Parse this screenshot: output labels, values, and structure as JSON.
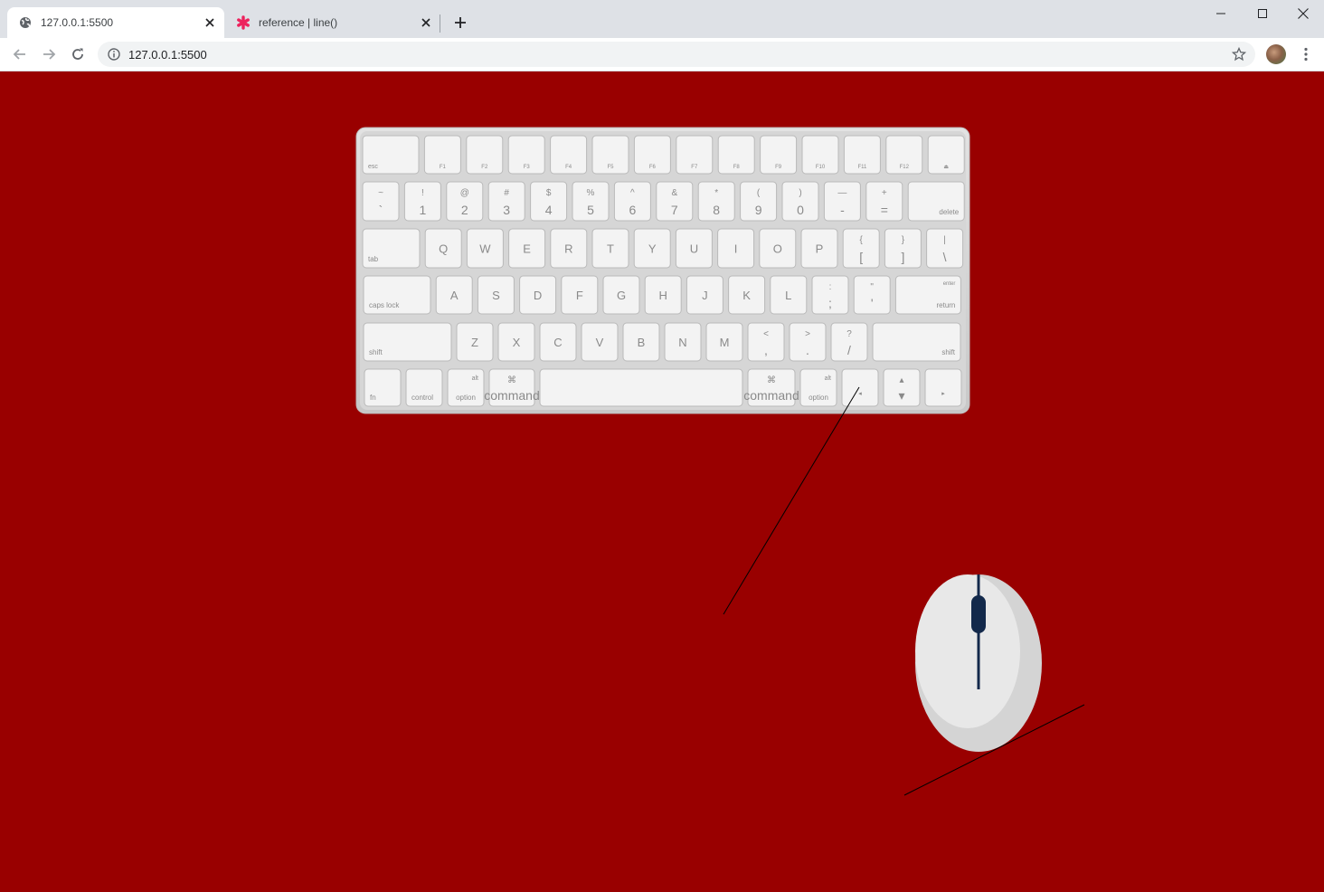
{
  "browser": {
    "tabs": [
      {
        "title": "127.0.0.1:5500",
        "icon": "globe-icon",
        "active": true
      },
      {
        "title": "reference | line()",
        "icon": "asterisk-icon",
        "active": false
      }
    ],
    "address": "127.0.0.1:5500",
    "colors": {
      "titlebar": "#dee1e6",
      "toolbar": "#ffffff",
      "omnibox": "#f1f3f4",
      "favicon_accent": "#ed225d"
    }
  },
  "canvas": {
    "background": "#990000",
    "line_color": "#000000",
    "keyboard": {
      "rows": [
        [
          [
            "esc",
            ""
          ],
          [
            "F1",
            ""
          ],
          [
            "F2",
            ""
          ],
          [
            "F3",
            ""
          ],
          [
            "F4",
            ""
          ],
          [
            "F5",
            ""
          ],
          [
            "F6",
            ""
          ],
          [
            "F7",
            ""
          ],
          [
            "F8",
            ""
          ],
          [
            "F9",
            ""
          ],
          [
            "F10",
            ""
          ],
          [
            "F11",
            ""
          ],
          [
            "F12",
            ""
          ],
          [
            "⏏",
            ""
          ]
        ],
        [
          [
            "~",
            "`"
          ],
          [
            "!",
            "1"
          ],
          [
            "@",
            "2"
          ],
          [
            "#",
            "3"
          ],
          [
            "$",
            "4"
          ],
          [
            "%",
            "5"
          ],
          [
            "^",
            "6"
          ],
          [
            "&",
            "7"
          ],
          [
            "*",
            "8"
          ],
          [
            "(",
            "9"
          ],
          [
            ")",
            "0"
          ],
          [
            "—",
            "-"
          ],
          [
            "+",
            "="
          ],
          [
            "delete",
            ""
          ]
        ],
        [
          [
            "tab",
            ""
          ],
          [
            "Q",
            ""
          ],
          [
            "W",
            ""
          ],
          [
            "E",
            ""
          ],
          [
            "R",
            ""
          ],
          [
            "T",
            ""
          ],
          [
            "Y",
            ""
          ],
          [
            "U",
            ""
          ],
          [
            "I",
            ""
          ],
          [
            "O",
            ""
          ],
          [
            "P",
            ""
          ],
          [
            "{",
            "["
          ],
          [
            "}",
            "]"
          ],
          [
            "|",
            "\\"
          ]
        ],
        [
          [
            "caps lock",
            ""
          ],
          [
            "A",
            ""
          ],
          [
            "S",
            ""
          ],
          [
            "D",
            ""
          ],
          [
            "F",
            ""
          ],
          [
            "G",
            ""
          ],
          [
            "H",
            ""
          ],
          [
            "J",
            ""
          ],
          [
            "K",
            ""
          ],
          [
            "L",
            ""
          ],
          [
            ":",
            ";"
          ],
          [
            "\"",
            "'"
          ],
          [
            "enter",
            "return"
          ]
        ],
        [
          [
            "shift",
            ""
          ],
          [
            "Z",
            ""
          ],
          [
            "X",
            ""
          ],
          [
            "C",
            ""
          ],
          [
            "V",
            ""
          ],
          [
            "B",
            ""
          ],
          [
            "N",
            ""
          ],
          [
            "M",
            ""
          ],
          [
            "<",
            ","
          ],
          [
            ">",
            "."
          ],
          [
            "?",
            "/"
          ],
          [
            "shift",
            ""
          ]
        ],
        [
          [
            "fn",
            ""
          ],
          [
            "control",
            ""
          ],
          [
            "alt",
            "option"
          ],
          [
            "⌘",
            "command"
          ],
          [
            "",
            ""
          ],
          [
            "⌘",
            "command"
          ],
          [
            "alt",
            "option"
          ],
          [
            "◂",
            ""
          ],
          [
            "▴",
            "▾"
          ],
          [
            "▸",
            ""
          ]
        ]
      ]
    },
    "mouse": {
      "body_color": "#e8e8e8",
      "shade_color": "#d4d4d4",
      "wheel_color": "#13294b"
    }
  }
}
